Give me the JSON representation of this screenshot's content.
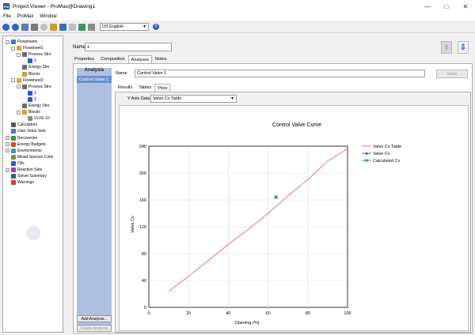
{
  "window": {
    "title": "Project Viewer - ProMax@Drawing1",
    "app_icon_label": "PM"
  },
  "menu": {
    "items": [
      "File",
      "ProMax",
      "Window"
    ]
  },
  "toolbar": {
    "language": "US English",
    "help_label": "?"
  },
  "tree": {
    "items": [
      {
        "label": "Flowsheets",
        "indent": 0,
        "expander": "-",
        "icon": "#4a73c2"
      },
      {
        "label": "Flowsheet1",
        "indent": 1,
        "expander": "-",
        "icon": "#d9a638"
      },
      {
        "label": "Process Stre",
        "indent": 2,
        "expander": "-",
        "icon": "#6c6c6c"
      },
      {
        "label": "1",
        "indent": 3,
        "expander": "",
        "icon": "#2a5bd7"
      },
      {
        "label": "Energy Stre",
        "indent": 2,
        "expander": "",
        "icon": "#6c6c6c"
      },
      {
        "label": "Blocks",
        "indent": 2,
        "expander": "",
        "icon": "#c9a23a"
      },
      {
        "label": "Flowsheet2",
        "indent": 1,
        "expander": "-",
        "icon": "#d9a638"
      },
      {
        "label": "Process Stre",
        "indent": 2,
        "expander": "-",
        "icon": "#6c6c6c"
      },
      {
        "label": "1",
        "indent": 3,
        "expander": "",
        "icon": "#2a5bd7"
      },
      {
        "label": "2",
        "indent": 3,
        "expander": "",
        "icon": "#2a5bd7"
      },
      {
        "label": "Energy Stre",
        "indent": 2,
        "expander": "",
        "icon": "#6c6c6c"
      },
      {
        "label": "Blocks",
        "indent": 2,
        "expander": "-",
        "icon": "#c9a23a"
      },
      {
        "label": "VLVE-10",
        "indent": 3,
        "expander": "",
        "icon": "#8a8a8a"
      },
      {
        "label": "Calculators",
        "indent": 0,
        "expander": "",
        "icon": "#555"
      },
      {
        "label": "User Value Sets",
        "indent": 0,
        "expander": "",
        "icon": "#4a73c2"
      },
      {
        "label": "Recoveries",
        "indent": 0,
        "expander": "+",
        "icon": "#3b8f3b"
      },
      {
        "label": "Energy Budgets",
        "indent": 0,
        "expander": "+",
        "icon": "#d24d2a"
      },
      {
        "label": "Environments",
        "indent": 0,
        "expander": "+",
        "icon": "#3a8fd0"
      },
      {
        "label": "Mixed Species Colle",
        "indent": 0,
        "expander": "",
        "icon": "#6c9a3a"
      },
      {
        "label": "Oils",
        "indent": 0,
        "expander": "",
        "icon": "#2a5bd7"
      },
      {
        "label": "Reaction Sets",
        "indent": 0,
        "expander": "+",
        "icon": "#9a3ad0"
      },
      {
        "label": "Solver Summary",
        "indent": 0,
        "expander": "",
        "icon": "#555"
      },
      {
        "label": "Warnings",
        "indent": 0,
        "expander": "",
        "icon": "#d23a2a"
      }
    ]
  },
  "header": {
    "name_label": "Name",
    "name_value": "1"
  },
  "tabs": [
    "Properties",
    "Composition",
    "Analyses",
    "Notes"
  ],
  "analysis_panel": {
    "heading": "Analysis",
    "selected_item": "Control Valve 1",
    "add_button": "Add Analysis...",
    "delete_button": "Delete Analysis"
  },
  "analysis_detail": {
    "name_label": "Name",
    "name_value": "Control Valve 1",
    "solve_button": "Solve"
  },
  "subtabs": [
    "Results",
    "Tables",
    "Plots"
  ],
  "plot_controls": {
    "y_axis_label": "Y Axis Data",
    "y_axis_value": "Valve Cv Table"
  },
  "chart_data": {
    "type": "line",
    "title": "Control Valve Curve",
    "xlabel": "Opening (%)",
    "ylabel": "Valve Cv",
    "xlim": [
      0,
      100
    ],
    "ylim": [
      0,
      240
    ],
    "x_ticks": [
      0,
      20,
      40,
      60,
      80,
      100
    ],
    "y_ticks": [
      0,
      40,
      80,
      120,
      160,
      200,
      240
    ],
    "grid": true,
    "legend_position": "top-right",
    "series": [
      {
        "name": "Valve Cv Table",
        "color": "#e86a7a",
        "marker": "none",
        "x": [
          10,
          20,
          30,
          40,
          50,
          60,
          70,
          80,
          90,
          100
        ],
        "y": [
          24,
          46,
          70,
          94,
          116,
          140,
          166,
          190,
          218,
          236
        ]
      },
      {
        "name": "Valve Cv",
        "color": "#3c5aa8",
        "marker": "triangle",
        "x": [],
        "y": []
      },
      {
        "name": "Calculated Cv",
        "color": "#2e7d4f",
        "marker": "x",
        "x": [
          64
        ],
        "y": [
          164
        ]
      }
    ]
  }
}
